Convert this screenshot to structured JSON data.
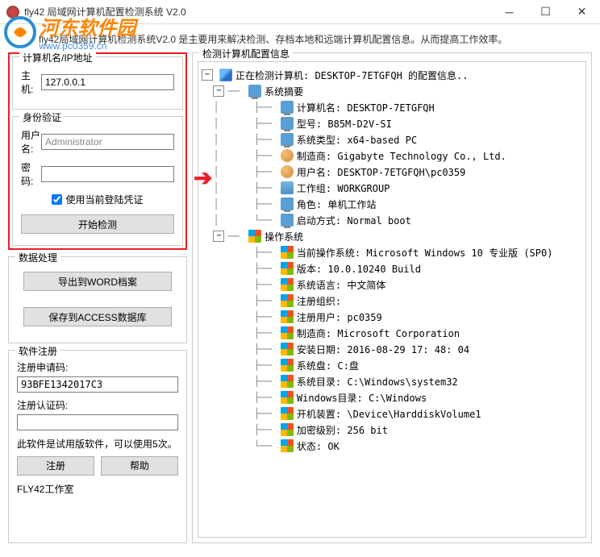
{
  "titlebar": {
    "title": "fly42 局域网计算机配置检测系统 V2.0"
  },
  "description": "fly42局域网计算机检测系统V2.0 是主要用来解决检测、存档本地和远端计算机配置信息。从而提高工作效率。",
  "watermark": {
    "text": "河东软件园",
    "url": "www.pc0359.cn"
  },
  "computer_section": {
    "title": "计算机名/IP地址",
    "host_label": "主机:",
    "host_value": "127.0.0.1"
  },
  "auth_section": {
    "title": "身份验证",
    "username_label": "用户名:",
    "username_value": "Administrator",
    "password_label": "密码:",
    "password_value": "",
    "use_current_label": "使用当前登陆凭证",
    "use_current_checked": true,
    "start_button": "开始检测"
  },
  "data_section": {
    "title": "数据处理",
    "export_word": "导出到WORD档案",
    "save_access": "保存到ACCESS数据库"
  },
  "register_section": {
    "title": "软件注册",
    "apply_label": "注册申请码:",
    "apply_value": "93BFE1342017C3",
    "auth_label": "注册认证码:",
    "auth_value": "",
    "note": "此软件是试用版软件，可以使用5次。",
    "register_btn": "注册",
    "help_btn": "帮助",
    "footer": "FLY42工作室"
  },
  "results": {
    "title": "检测计算机配置信息",
    "root": "正在检测计算机: DESKTOP-7ETGFQH 的配置信息..",
    "summary_title": "系统摘要",
    "summary": [
      {
        "icon": "monitor",
        "label": "计算机名: ",
        "value": "DESKTOP-7ETGFQH"
      },
      {
        "icon": "monitor",
        "label": "型号: ",
        "value": "B85M-D2V-SI"
      },
      {
        "icon": "monitor",
        "label": "系统类型: ",
        "value": "x64-based PC"
      },
      {
        "icon": "users",
        "label": "制造商: ",
        "value": "Gigabyte Technology Co., Ltd."
      },
      {
        "icon": "users",
        "label": "用户名: ",
        "value": "DESKTOP-7ETGFQH\\pc0359"
      },
      {
        "icon": "group",
        "label": "工作组: ",
        "value": "WORKGROUP"
      },
      {
        "icon": "monitor",
        "label": "角色: ",
        "value": "单机工作站"
      },
      {
        "icon": "monitor",
        "label": "启动方式: ",
        "value": "Normal boot"
      }
    ],
    "os_title": "操作系统",
    "os": [
      {
        "label": "当前操作系统: ",
        "value": "Microsoft Windows 10 专业版 (SP0)"
      },
      {
        "label": "版本: ",
        "value": "10.0.10240 Build"
      },
      {
        "label": "系统语言: ",
        "value": "中文简体"
      },
      {
        "label": "注册组织: ",
        "value": ""
      },
      {
        "label": "注册用户: ",
        "value": "pc0359"
      },
      {
        "label": "制造商: ",
        "value": "Microsoft Corporation"
      },
      {
        "label": "安装日期: ",
        "value": "2016-08-29 17: 48: 04"
      },
      {
        "label": "系统盘: ",
        "value": "C:盘"
      },
      {
        "label": "系统目录: ",
        "value": "C:\\Windows\\system32"
      },
      {
        "label": "Windows目录: ",
        "value": "C:\\Windows"
      },
      {
        "label": "开机装置: ",
        "value": "\\Device\\HarddiskVolume1"
      },
      {
        "label": "加密级别: ",
        "value": "256 bit"
      },
      {
        "label": "状态: ",
        "value": "OK"
      }
    ]
  }
}
